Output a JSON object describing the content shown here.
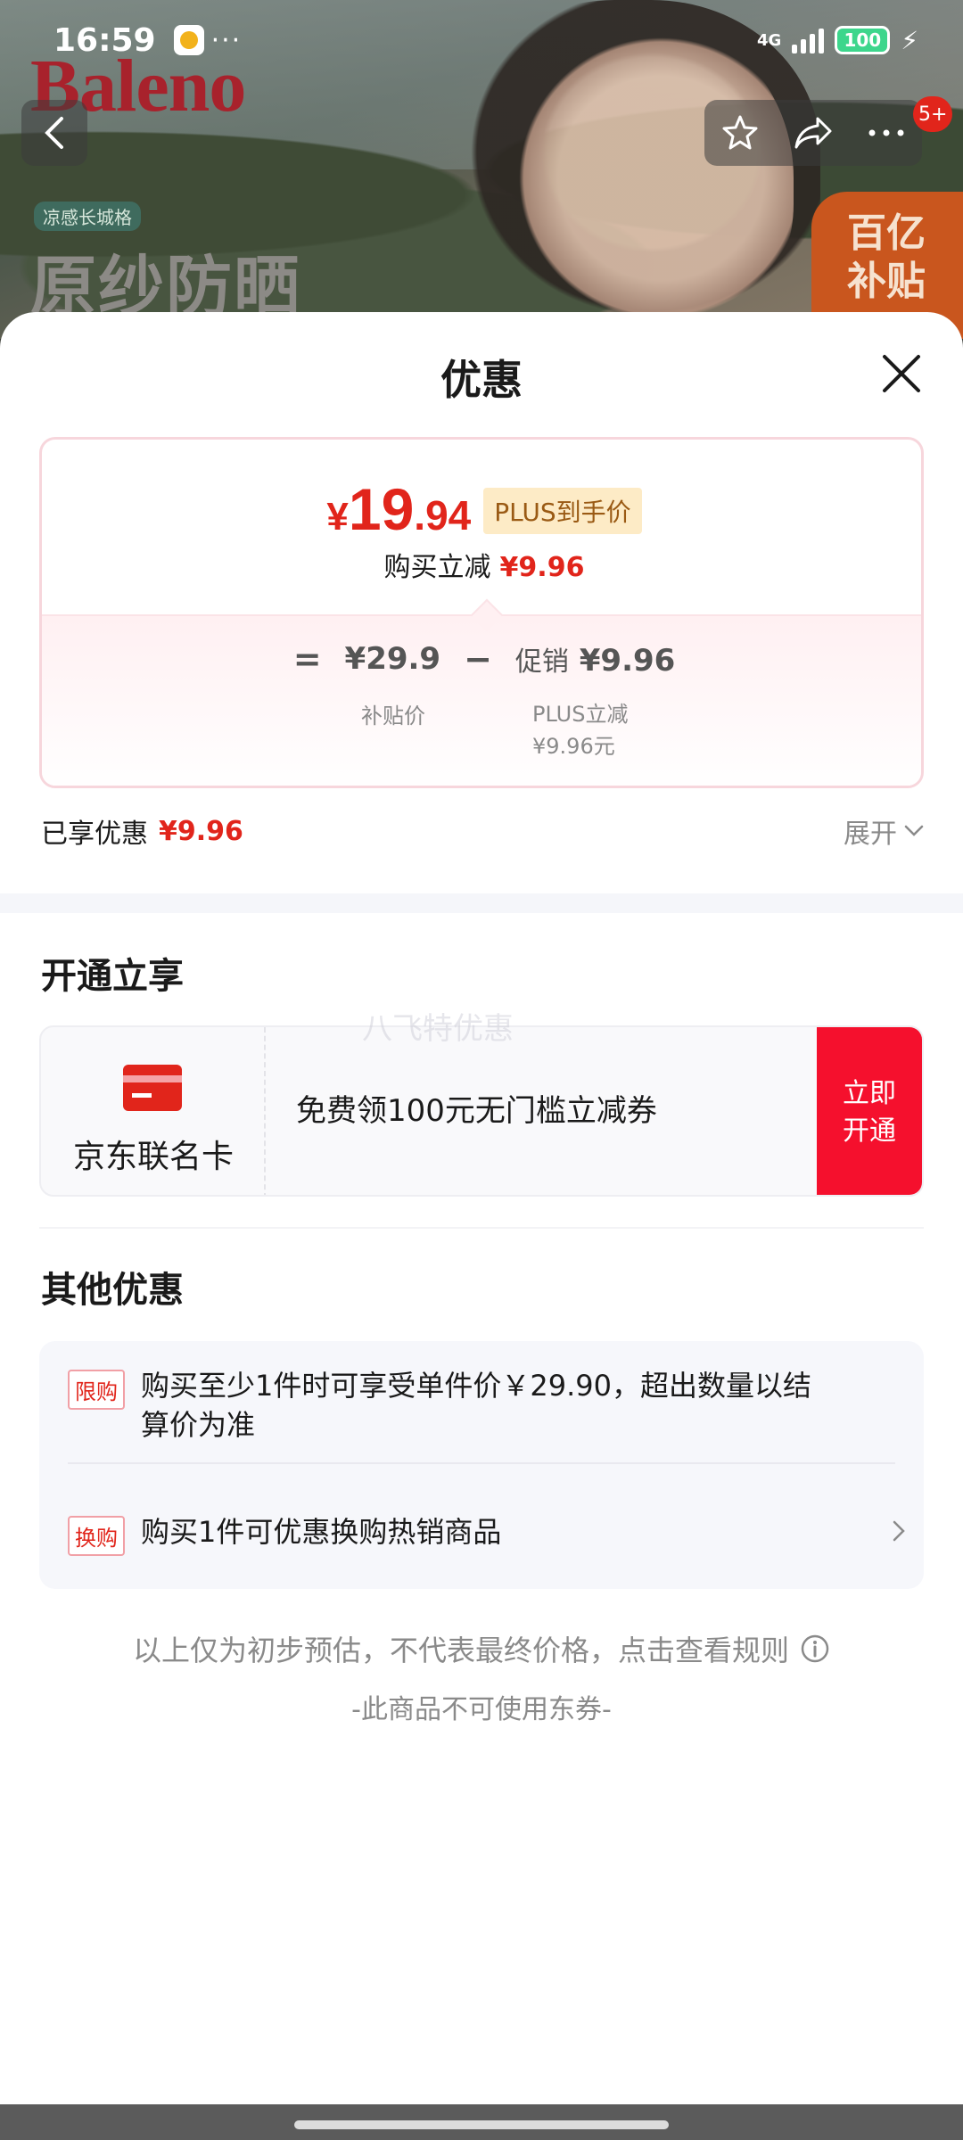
{
  "status_bar": {
    "time": "16:59",
    "network": "4G",
    "battery": "100",
    "dots": "···"
  },
  "hero": {
    "brand": "Baleno",
    "tag": "凉感长城格",
    "title": "原纱防晒",
    "badge_line1": "百亿",
    "badge_line2": "补贴",
    "cart_count": "5+"
  },
  "sheet": {
    "title": "优惠",
    "price": {
      "yen": "¥",
      "integer": "19",
      "decimal": ".94",
      "plus_tag": "PLUS到手价",
      "instant_label": "购买立减",
      "instant_value": "¥9.96"
    },
    "formula": {
      "equals": "=",
      "subsidy_price": "¥29.9",
      "minus": "−",
      "promo_label": "促销",
      "promo_value": "¥9.96",
      "subsidy_note": "补贴价",
      "plus_note_line1": "PLUS立减",
      "plus_note_line2": "¥9.96元"
    },
    "enjoyed": {
      "label": "已享优惠",
      "value": "¥9.96",
      "expand": "展开"
    },
    "open_section": {
      "title": "开通立享",
      "card_name": "京东联名卡",
      "card_desc": "免费领100元无门槛立减券",
      "card_button": "立即开通",
      "watermark": "八飞特优惠"
    },
    "other_section": {
      "title": "其他优惠",
      "items": [
        {
          "tag": "限购",
          "text": "购买至少1件时可享受单件价￥29.90，超出数量以结算价为准"
        },
        {
          "tag": "换购",
          "text": "购买1件可优惠换购热销商品"
        }
      ]
    },
    "disclaimer": "以上仅为初步预估，不代表最终价格，点击查看规则",
    "no_coupon": "-此商品不可使用东券-"
  },
  "colors": {
    "accent_red": "#e1251b",
    "plus_bg": "#fdebc6",
    "button_red": "#f5102d"
  }
}
